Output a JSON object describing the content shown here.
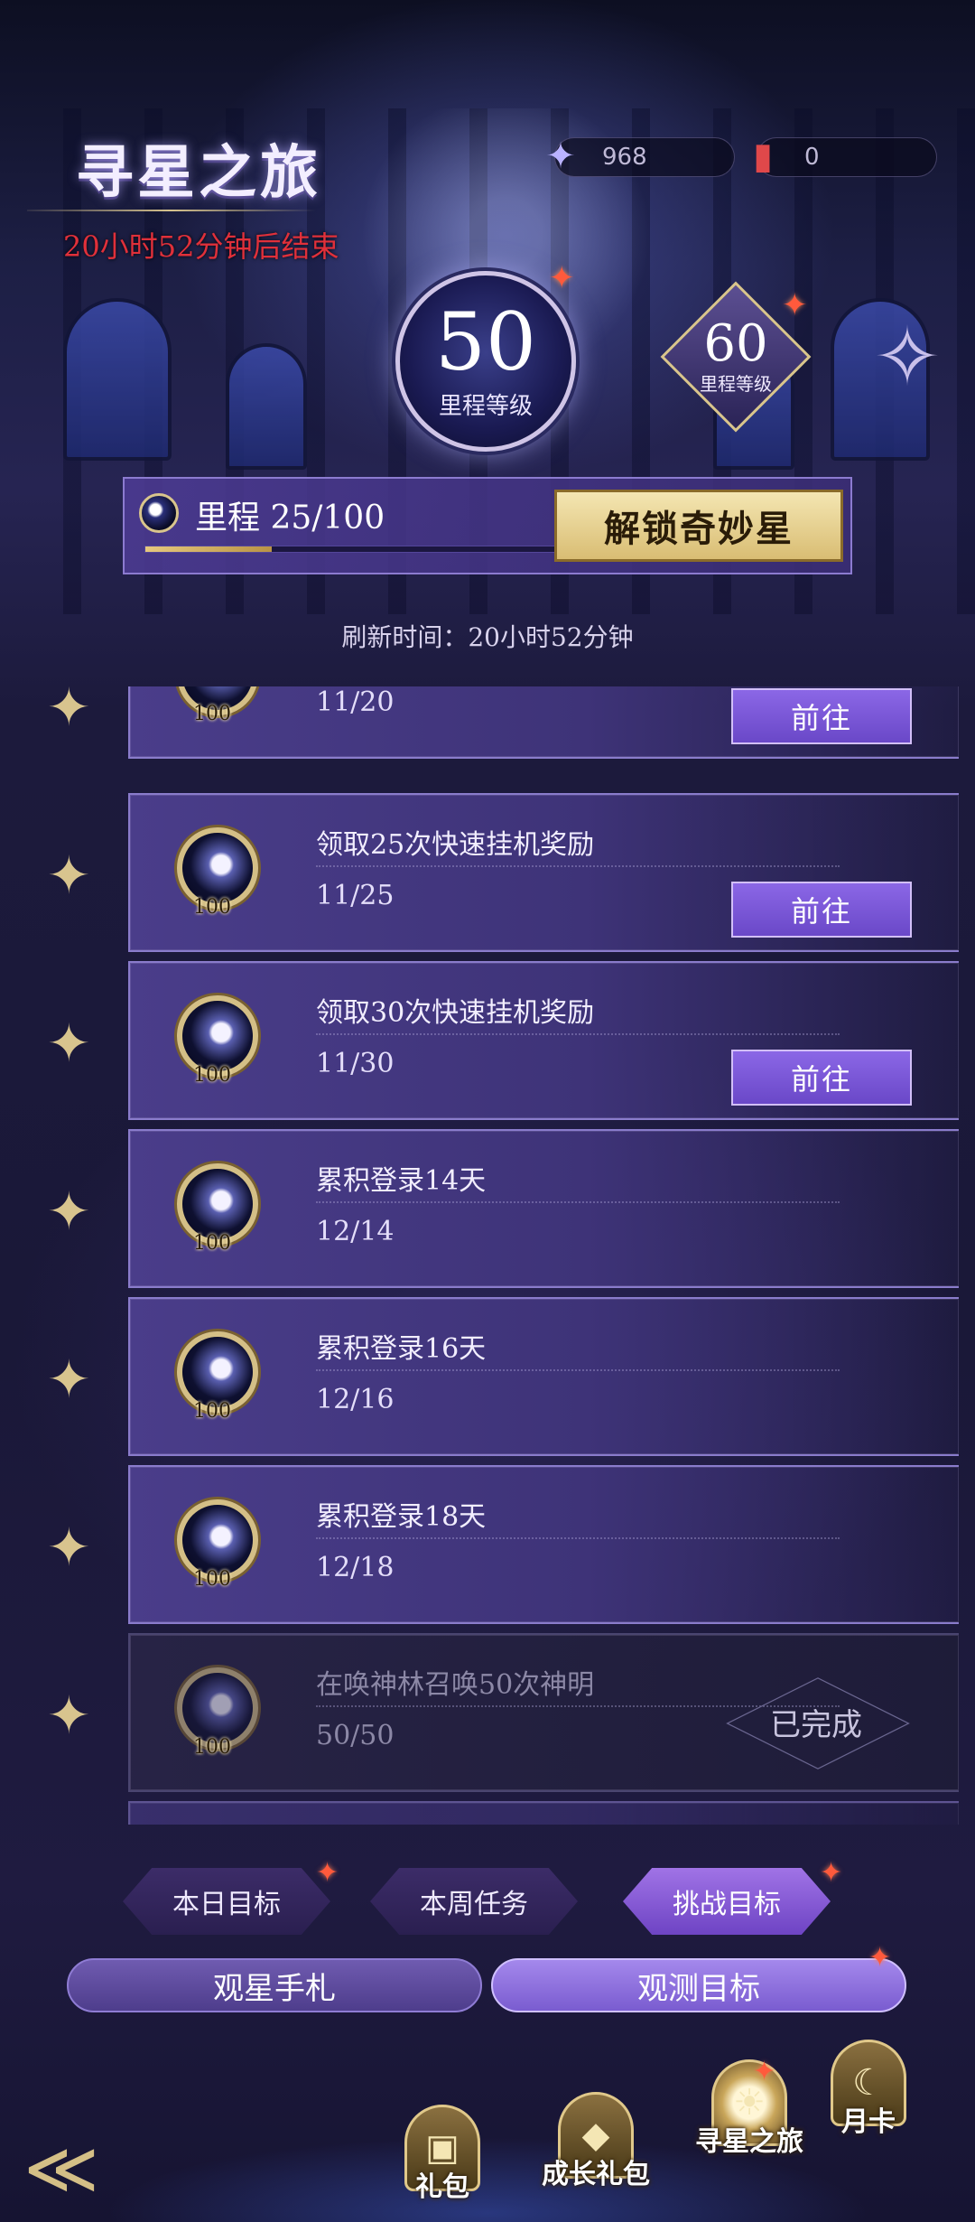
{
  "header": {
    "title": "寻星之旅",
    "countdown": "20小时52分钟后结束"
  },
  "currencies": [
    {
      "icon": "star-crystal-icon",
      "value": "968"
    },
    {
      "icon": "ticket-card-icon",
      "value": "0"
    }
  ],
  "level": {
    "current": "50",
    "current_label": "里程等级",
    "next": "60",
    "next_label": "里程等级"
  },
  "mileage": {
    "label": "里程 25/100",
    "progress": 0.25,
    "unlock_label": "解锁奇妙星"
  },
  "refresh_text": "刷新时间：20小时52分钟",
  "tasks": [
    {
      "name": "",
      "reward": "100",
      "progress": "11/20",
      "button": "前往",
      "done": false
    },
    {
      "name": "领取25次快速挂机奖励",
      "reward": "100",
      "progress": "11/25",
      "button": "前往",
      "done": false
    },
    {
      "name": "领取30次快速挂机奖励",
      "reward": "100",
      "progress": "11/30",
      "button": "前往",
      "done": false
    },
    {
      "name": "累积登录14天",
      "reward": "100",
      "progress": "12/14",
      "button": "",
      "done": false
    },
    {
      "name": "累积登录16天",
      "reward": "100",
      "progress": "12/16",
      "button": "",
      "done": false
    },
    {
      "name": "累积登录18天",
      "reward": "100",
      "progress": "12/18",
      "button": "",
      "done": false
    },
    {
      "name": "在唤神林召唤50次神明",
      "reward": "100",
      "progress": "50/50",
      "button": "已完成",
      "done": true
    }
  ],
  "tabs": [
    {
      "label": "本日目标",
      "active": false
    },
    {
      "label": "本周任务",
      "active": false
    },
    {
      "label": "挑战目标",
      "active": true
    }
  ],
  "subtabs": [
    {
      "label": "观星手札",
      "active": false
    },
    {
      "label": "观测目标",
      "active": true
    }
  ],
  "bottom_nav": [
    {
      "label": "礼包",
      "icon": "gift-icon"
    },
    {
      "label": "成长礼包",
      "icon": "growth-pack-icon"
    },
    {
      "label": "寻星之旅",
      "icon": "sun-emblem-icon",
      "active": true
    },
    {
      "label": "月卡",
      "icon": "month-card-icon"
    }
  ],
  "colors": {
    "countdown_red": "#e0303a",
    "accent_purple": "#7a5cd0",
    "gold": "#d9c58c"
  }
}
